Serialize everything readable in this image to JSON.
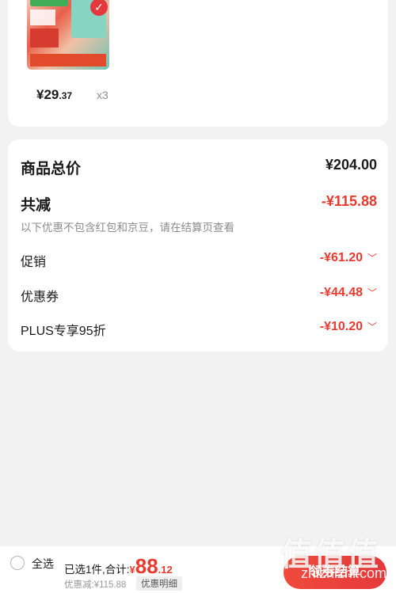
{
  "product": {
    "price_int": "¥29",
    "price_dec": ".37",
    "quantity": "x3"
  },
  "summary": {
    "total_label": "商品总价",
    "total_value": "¥204.00",
    "reduce_label": "共减",
    "reduce_value": "-¥115.88",
    "note": "以下优惠不包含红包和京豆，请在结算页查看",
    "items": [
      {
        "label": "促销",
        "value": "-¥61.20"
      },
      {
        "label": "优惠券",
        "value": "-¥44.48"
      },
      {
        "label": "PLUS专享95折",
        "value": "-¥10.20"
      }
    ]
  },
  "bottom_bar": {
    "select_all": "全选",
    "selected_prefix": "已选1件,合计:",
    "currency": "¥",
    "total_int": "88",
    "total_dec": ".12",
    "discount_text": "优惠减:¥115.88",
    "detail_button": "优惠明细",
    "checkout_button": "领券结算"
  },
  "watermark": {
    "big": "值值值",
    "small": "zhizhizhi.com"
  },
  "colors": {
    "accent": "#e83a2f",
    "background": "#f2f2f2",
    "card": "#ffffff"
  }
}
